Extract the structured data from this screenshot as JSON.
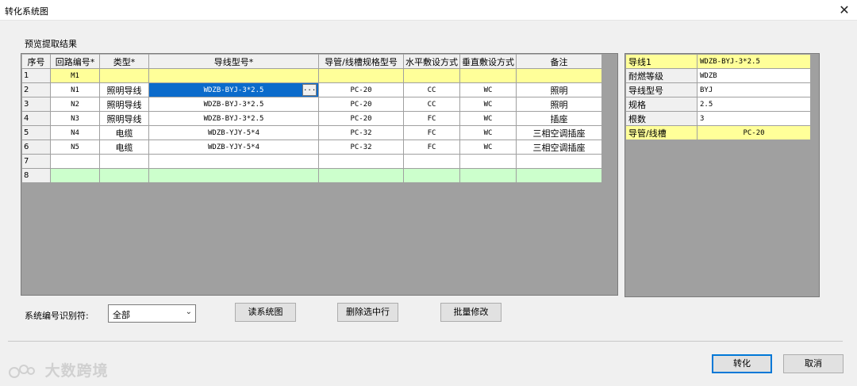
{
  "window": {
    "title": "转化系统图",
    "close_glyph": "✕"
  },
  "section_label": "预览提取结果",
  "grid": {
    "headers": [
      "序号",
      "回路编号*",
      "类型*",
      "导线型号*",
      "导管/线槽规格型号",
      "水平敷设方式",
      "垂直敷设方式",
      "备注"
    ],
    "rows": [
      [
        "1",
        "M1",
        "",
        "",
        "",
        "",
        "",
        ""
      ],
      [
        "2",
        "N1",
        "照明导线",
        "WDZB-BYJ-3*2.5",
        "PC-20",
        "CC",
        "WC",
        "照明"
      ],
      [
        "3",
        "N2",
        "照明导线",
        "WDZB-BYJ-3*2.5",
        "PC-20",
        "CC",
        "WC",
        "照明"
      ],
      [
        "4",
        "N3",
        "照明导线",
        "WDZB-BYJ-3*2.5",
        "PC-20",
        "FC",
        "WC",
        "插座"
      ],
      [
        "5",
        "N4",
        "电缆",
        "WDZB-YJY-5*4",
        "PC-32",
        "FC",
        "WC",
        "三相空调插座"
      ],
      [
        "6",
        "N5",
        "电缆",
        "WDZB-YJY-5*4",
        "PC-32",
        "FC",
        "WC",
        "三相空调插座"
      ],
      [
        "7",
        "",
        "",
        "",
        "",
        "",
        "",
        ""
      ],
      [
        "8",
        "",
        "",
        "",
        "",
        "",
        "",
        ""
      ]
    ],
    "selected_cell_button": "...",
    "highlight_colors": {
      "yellow": "#ffff99",
      "green": "#ccffcc",
      "selected": "#0b6bcb"
    }
  },
  "properties": [
    {
      "key": "导线1",
      "value": "WDZB-BYJ-3*2.5"
    },
    {
      "key": "耐燃等级",
      "value": "WDZB"
    },
    {
      "key": "导线型号",
      "value": "BYJ"
    },
    {
      "key": "规格",
      "value": "2.5"
    },
    {
      "key": "根数",
      "value": "3"
    },
    {
      "key": "导管/线槽",
      "value": "PC-20"
    }
  ],
  "controls": {
    "id_label": "系统编号识别符:",
    "combo_value": "全部",
    "read_button": "读系统图",
    "delete_button": "删除选中行",
    "batch_button": "批量修改",
    "convert_button": "转化",
    "cancel_button": "取消"
  },
  "watermark": "大数跨境"
}
